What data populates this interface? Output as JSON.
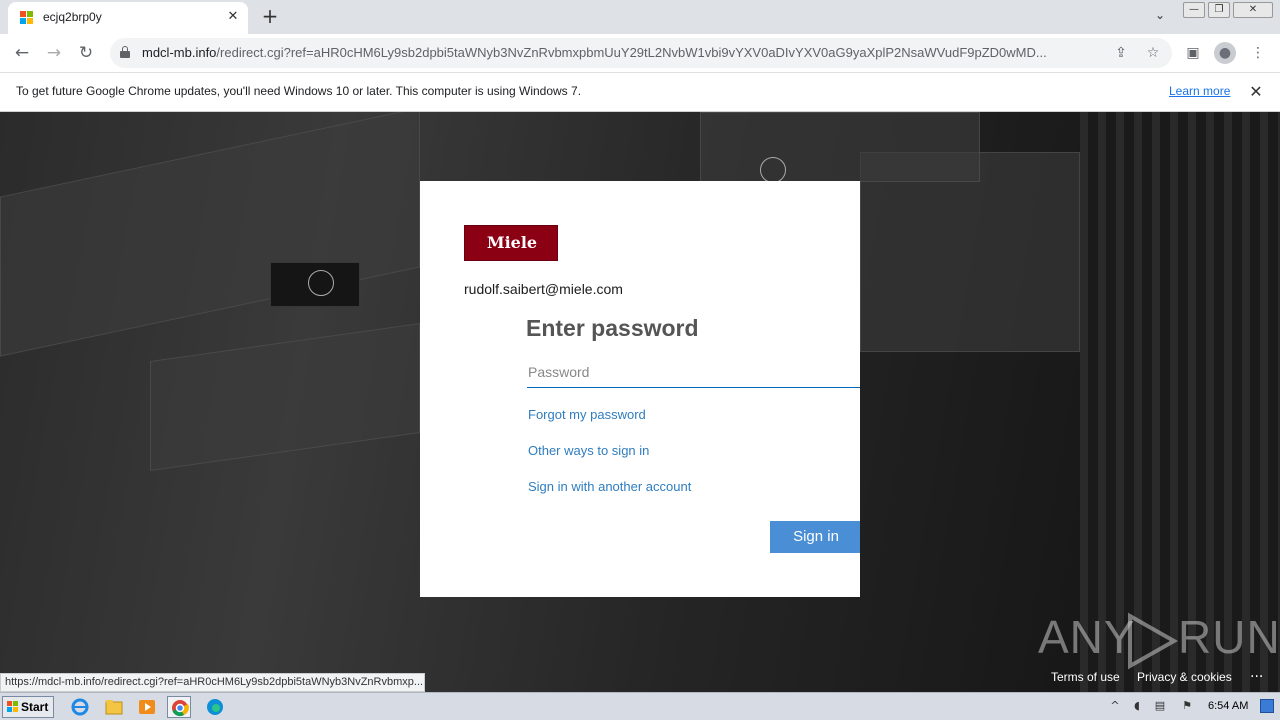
{
  "tab": {
    "title": "ecjq2brp0y",
    "close": "✕"
  },
  "new_tab": "+",
  "tab_search": "⌄",
  "window_controls": {
    "minimize": "—",
    "restore": "❐",
    "close": "✕"
  },
  "nav": {
    "back": "←",
    "forward": "→",
    "reload": "↻"
  },
  "address": {
    "host": "mdcl-mb.info",
    "path": "/redirect.cgi?ref=aHR0cHM6Ly9sb2dpbi5taWNyb3NvZnRvbmxpbmUuY29tL2NvbW1vbi9vYXV0aDIvYXV0aG9yaXplP2NsaWVudF9pZD0wMD..."
  },
  "omnibox_icons": {
    "share": "⇪",
    "star": "☆"
  },
  "toolbar_icons": {
    "side_panel": "▣",
    "profile": "●",
    "menu": "⋮"
  },
  "infobar": {
    "message": "To get future Google Chrome updates, you'll need Windows 10 or later. This computer is using Windows 7.",
    "link": "Learn more",
    "close": "✕"
  },
  "login": {
    "logo_text": "Miele",
    "email": "rudolf.saibert@miele.com",
    "heading": "Enter password",
    "password_placeholder": "Password",
    "forgot": "Forgot my password",
    "other_ways": "Other ways to sign in",
    "another_account": "Sign in with another account",
    "signin_button": "Sign in"
  },
  "watermark": {
    "left": "ANY",
    "right": "RUN"
  },
  "footer": {
    "terms": "Terms of use",
    "privacy": "Privacy & cookies",
    "more": "..."
  },
  "status_url": "https://mdcl-mb.info/redirect.cgi?ref=aHR0cHM6Ly9sb2dpbi5taWNyb3NvZnRvbmxp...",
  "taskbar": {
    "start": "Start",
    "clock": "6:54 AM"
  },
  "colors": {
    "brand": "#8c0014",
    "accent": "#4a8ed6",
    "link": "#2f7dbf"
  }
}
